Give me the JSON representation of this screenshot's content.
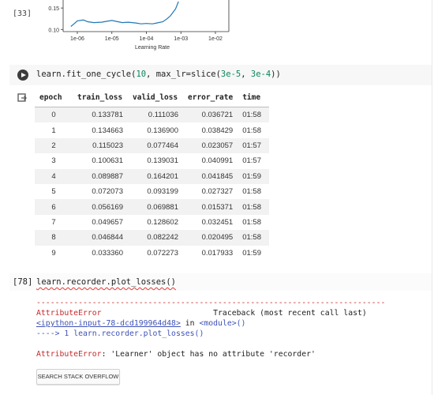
{
  "plot_cell": {
    "exec_count": "[33]",
    "chart_data": {
      "type": "line",
      "xlabel": "Learning Rate",
      "ylabel": "",
      "x_scale": "log",
      "x_ticks": [
        "1e-06",
        "1e-05",
        "1e-04",
        "1e-03",
        "1e-02"
      ],
      "y_ticks": [
        "0.15",
        "0.10"
      ],
      "ylim": [
        0.095,
        0.165
      ],
      "line_color": "#1f77b4",
      "series": [
        {
          "x": [
            6.5e-07,
            8e-07,
            1e-06,
            1.5e-06,
            2e-06,
            3e-06,
            5e-06,
            7e-06,
            1e-05,
            1.5e-05,
            2e-05,
            3e-05,
            5e-05,
            7e-05,
            0.0001,
            0.00015,
            0.0002,
            0.0003,
            0.0004,
            0.0005,
            0.0007,
            0.00085
          ],
          "y": [
            0.107,
            0.113,
            0.12,
            0.122,
            0.118,
            0.116,
            0.117,
            0.119,
            0.121,
            0.118,
            0.116,
            0.117,
            0.115,
            0.113,
            0.114,
            0.113,
            0.115,
            0.118,
            0.125,
            0.132,
            0.148,
            0.165
          ]
        }
      ]
    }
  },
  "code_cell": {
    "prefix": "learn.fit_one_cycle(",
    "arg1": "10",
    "mid": ", max_lr=slice(",
    "arg2": "3e-5",
    "sep": ", ",
    "arg3": "3e-4",
    "suffix": "))"
  },
  "results_table": {
    "headers": [
      "epoch",
      "train_loss",
      "valid_loss",
      "error_rate",
      "time"
    ],
    "rows": [
      [
        "0",
        "0.133781",
        "0.111036",
        "0.036721",
        "01:58"
      ],
      [
        "1",
        "0.134663",
        "0.136900",
        "0.038429",
        "01:58"
      ],
      [
        "2",
        "0.115023",
        "0.077464",
        "0.023057",
        "01:57"
      ],
      [
        "3",
        "0.100631",
        "0.139031",
        "0.040991",
        "01:57"
      ],
      [
        "4",
        "0.089887",
        "0.164201",
        "0.041845",
        "01:59"
      ],
      [
        "5",
        "0.072073",
        "0.093199",
        "0.027327",
        "01:58"
      ],
      [
        "6",
        "0.056169",
        "0.069881",
        "0.015371",
        "01:58"
      ],
      [
        "7",
        "0.049657",
        "0.128602",
        "0.032451",
        "01:58"
      ],
      [
        "8",
        "0.046844",
        "0.082242",
        "0.020495",
        "01:58"
      ],
      [
        "9",
        "0.033360",
        "0.072273",
        "0.017933",
        "01:59"
      ]
    ]
  },
  "error_cell": {
    "exec_count": "[78]",
    "code": "learn.recorder.plot_losses()",
    "dash_line": "---------------------------------------------------------------------------",
    "error_name": "AttributeError",
    "traceback_label": "Traceback (most recent call last)",
    "input_link": "<ipython-input-78-dcd199964d48>",
    "in_text": " in ",
    "module_text": "<module>()",
    "arrow": "----> 1 ",
    "arrow_code": "learn.recorder.plot_losses()",
    "error_message": ": 'Learner' object has no attribute 'recorder'",
    "search_button": "SEARCH STACK OVERFLOW"
  }
}
